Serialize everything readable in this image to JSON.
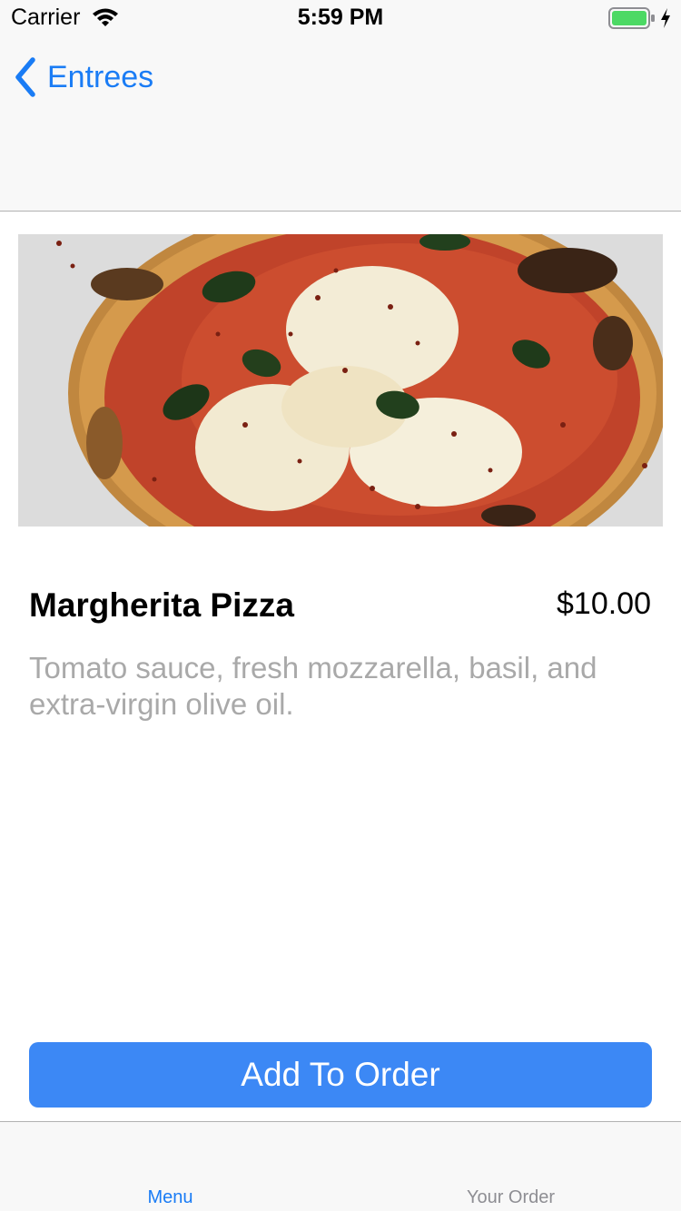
{
  "status_bar": {
    "carrier": "Carrier",
    "time": "5:59 PM",
    "battery_color": "#4cd964"
  },
  "nav": {
    "back_label": "Entrees"
  },
  "item": {
    "image_icon": "pizza-photo",
    "name": "Margherita Pizza",
    "price": "$10.00",
    "description": "Tomato sauce, fresh mozzarella, basil, and extra-virgin olive oil."
  },
  "actions": {
    "add_label": "Add To Order",
    "button_color": "#3c88f5"
  },
  "tab_bar": {
    "tabs": [
      {
        "label": "Menu",
        "selected": true
      },
      {
        "label": "Your Order",
        "selected": false
      }
    ]
  }
}
